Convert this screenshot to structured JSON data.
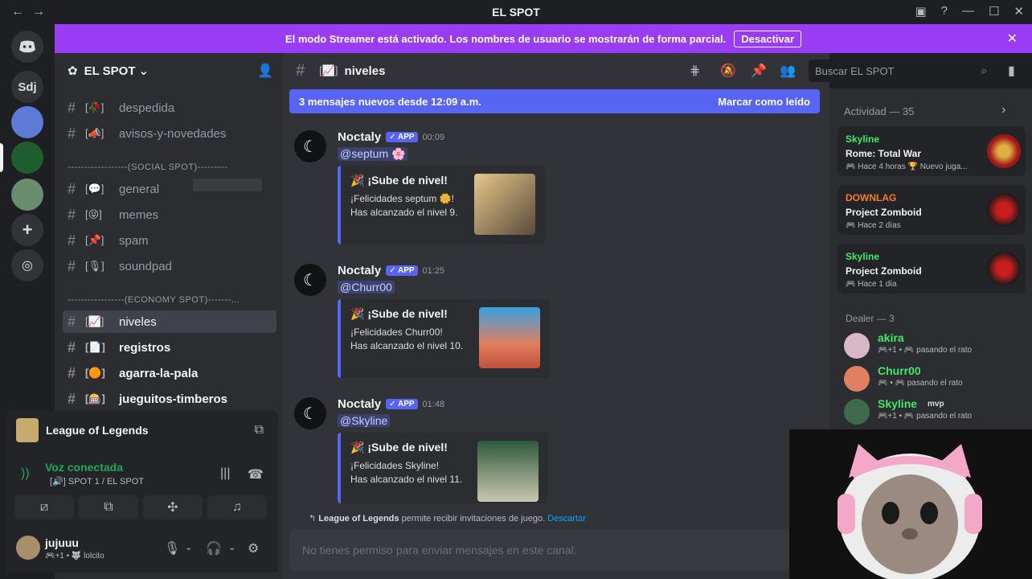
{
  "window": {
    "title": "EL SPOT",
    "nav_back": "←",
    "nav_fwd": "→",
    "controls": [
      "▣",
      "?",
      "—",
      "☐",
      "✕"
    ]
  },
  "rail": {
    "home_icon": "discord-logo",
    "sdj": "Sdj"
  },
  "banner": {
    "text": "El modo Streamer está activado. Los nombres de usuario se mostrarán de forma parcial.",
    "button": "Desactivar",
    "close": "✕"
  },
  "server": {
    "name": "EL SPOT",
    "chevron": "⌄"
  },
  "channels": [
    {
      "emoji": "[🥀]",
      "name": "despedida"
    },
    {
      "emoji": "[📣]",
      "name": "avisos-y-novedades"
    }
  ],
  "categories": {
    "social": "------------------(SOCIAL SPOT)---------",
    "economy": "-----------------(ECONOMY SPOT)-------..."
  },
  "social_channels": [
    {
      "emoji": "[💬]",
      "name": "general"
    },
    {
      "emoji": "[😝]",
      "name": "memes"
    },
    {
      "emoji": "[📌]",
      "name": "spam"
    },
    {
      "emoji": "[🎙]",
      "name": "soundpad"
    }
  ],
  "economy_channels": [
    {
      "emoji": "[📈]",
      "name": "niveles"
    },
    {
      "emoji": "[📄]",
      "name": "registros"
    },
    {
      "emoji": "[🟠]",
      "name": "agarra-la-pala"
    },
    {
      "emoji": "[🎰]",
      "name": "jueguitos-timberos"
    }
  ],
  "voice": {
    "game": "League of Legends",
    "status": "Voz conectada",
    "channel": "[🔊] SPOT 1 / EL SPOT"
  },
  "user": {
    "name": "jujuuu",
    "status": "🎮+1 • 🐺 lolcito"
  },
  "chat": {
    "channel_emoji": "[📈]",
    "channel": "niveles",
    "search_placeholder": "Buscar EL SPOT",
    "new_messages": "3 mensajes nuevos desde 12:09 a.m.",
    "mark_read": "Marcar como leído",
    "invite_game": "League of Legends",
    "invite_text": "permite recibir invitaciones de juego.",
    "invite_link": "Descartar",
    "composer": "No tienes permiso para enviar mensajes en este canal."
  },
  "messages": [
    {
      "author": "Noctaly",
      "badge": "✓ APP",
      "time": "00:09",
      "mention": "@septum 🌸",
      "embed_title": "🎉 ¡Sube de nivel!",
      "embed_line1": "¡Felicidades septum 🌼!",
      "embed_line2": "Has alcanzado el nivel 9."
    },
    {
      "author": "Noctaly",
      "badge": "✓ APP",
      "time": "01:25",
      "mention": "@Churr00",
      "embed_title": "🎉 ¡Sube de nivel!",
      "embed_line1": "¡Felicidades Churr00!",
      "embed_line2": "Has alcanzado el nivel 10."
    },
    {
      "author": "Noctaly",
      "badge": "✓ APP",
      "time": "01:48",
      "mention": "@Skyline",
      "embed_title": "🎉 ¡Sube de nivel!",
      "embed_line1": "¡Felicidades Skyline!",
      "embed_line2": "Has alcanzado el nivel 11."
    }
  ],
  "activity": {
    "header": "Actividad — 35",
    "cards": [
      {
        "user": "Skyline",
        "color": "#43e866",
        "game": "Rome: Total War",
        "sub": "🎮 Hace 4 horas  🏆 Nuevo juga..."
      },
      {
        "user": "DOWNLAG",
        "color": "#f47b2b",
        "game": "Project Zomboid",
        "sub": "🎮 Hace 2 días"
      },
      {
        "user": "Skyline",
        "color": "#43e866",
        "game": "Project Zomboid",
        "sub": "🎮 Hace 1 día"
      }
    ],
    "role": "Dealer — 3",
    "members": [
      {
        "name": "akira",
        "status": "🎮+1 • 🎮 pasando el rato"
      },
      {
        "name": "Churr00",
        "status": "🎮 • 🎮 pasando el rato"
      },
      {
        "name": "Skyline",
        "tag": "mvp",
        "status": "🎮+1 • 🎮 pasando el rato"
      }
    ]
  }
}
